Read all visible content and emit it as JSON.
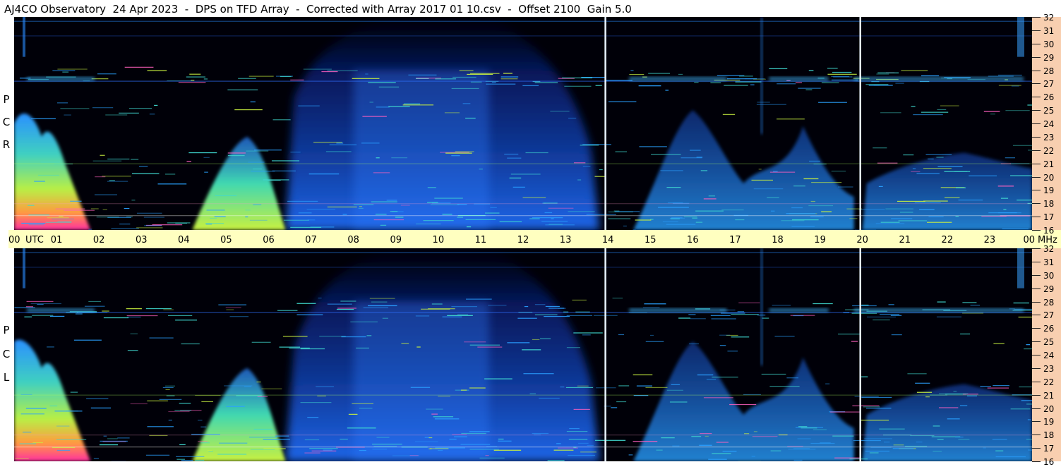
{
  "title": "AJ4CO Observatory  24 Apr 2023  -  DPS on TFD Array  -  Corrected with Array 2017 01 10.csv  -  Offset 2100  Gain 5.0",
  "chart_data": [
    {
      "type": "heatmap",
      "panel": "top",
      "polarization_label": [
        "R",
        "C",
        "P"
      ],
      "x_axis": {
        "tick_labels": [
          "00",
          "01",
          "02",
          "03",
          "04",
          "05",
          "06",
          "07",
          "08",
          "09",
          "10",
          "11",
          "12",
          "13",
          "14",
          "15",
          "16",
          "17",
          "18",
          "19",
          "20",
          "21",
          "22",
          "23",
          "00"
        ],
        "unit_label": "UTC",
        "range_hours": [
          0,
          24
        ]
      },
      "y_axis": {
        "tick_labels": [
          "32",
          "31",
          "30",
          "29",
          "28",
          "27",
          "26",
          "25",
          "24",
          "23",
          "22",
          "21",
          "20",
          "19",
          "18",
          "17",
          "16"
        ],
        "unit_label": "MHz",
        "range_mhz": [
          16,
          32
        ]
      }
    },
    {
      "type": "heatmap",
      "panel": "bottom",
      "polarization_label": [
        "L",
        "C",
        "P"
      ],
      "x_axis": {
        "tick_labels": [
          "00",
          "01",
          "02",
          "03",
          "04",
          "05",
          "06",
          "07",
          "08",
          "09",
          "10",
          "11",
          "12",
          "13",
          "14",
          "15",
          "16",
          "17",
          "18",
          "19",
          "20",
          "21",
          "22",
          "23",
          "00"
        ],
        "unit_label": "UTC",
        "range_hours": [
          0,
          24
        ]
      },
      "y_axis": {
        "tick_labels": [
          "32",
          "31",
          "30",
          "29",
          "28",
          "27",
          "26",
          "25",
          "24",
          "23",
          "22",
          "21",
          "20",
          "19",
          "18",
          "17",
          "16"
        ],
        "unit_label": "MHz",
        "range_mhz": [
          16,
          32
        ]
      }
    }
  ],
  "colors": {
    "background": "#000008",
    "low": "#0a2a80",
    "mid": "#1e7cff",
    "high": "#9be84a",
    "peak": "#ff2fa0",
    "utc_bar": "#ffffc0",
    "freq_strip": "#f8cfb0"
  }
}
